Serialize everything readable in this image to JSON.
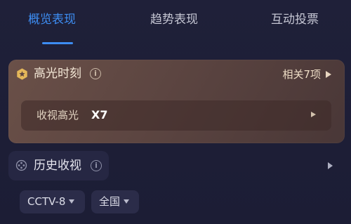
{
  "tabs": [
    {
      "label": "概览表现",
      "active": true
    },
    {
      "label": "趋势表现",
      "active": false
    },
    {
      "label": "互动投票",
      "active": false
    }
  ],
  "highlights": {
    "title": "高光时刻",
    "related": "相关7项",
    "icon": "star-badge-icon",
    "row": {
      "label": "收视高光",
      "count": "X7"
    }
  },
  "history": {
    "title": "历史收视",
    "icon": "rating-dial-icon",
    "filters": [
      {
        "label": "CCTV-8"
      },
      {
        "label": "全国"
      }
    ]
  },
  "colors": {
    "background": "#1d1e36",
    "accent": "#3d8df2",
    "highlight_card": "#5c4541"
  }
}
